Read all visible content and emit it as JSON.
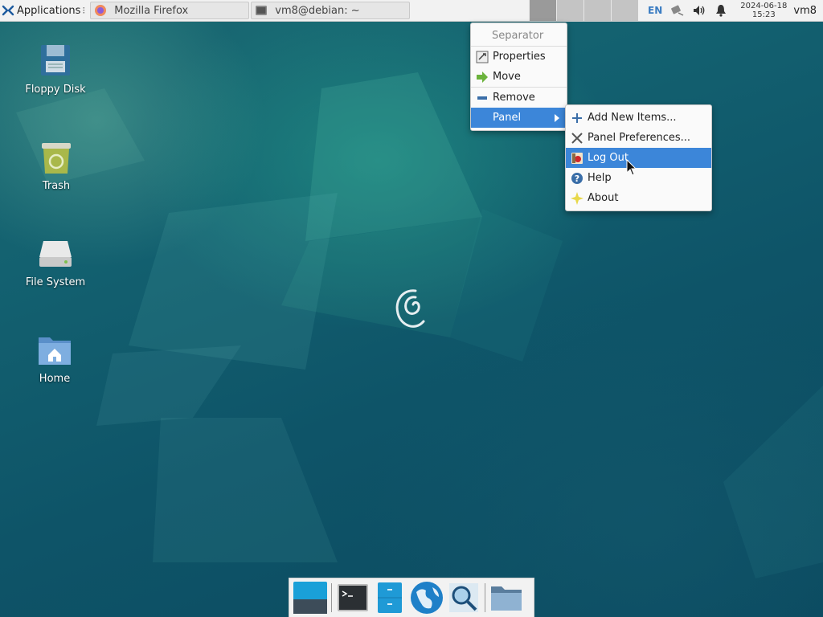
{
  "top_panel": {
    "applications_label": "Applications",
    "applications_icon": "xfce-mouse-icon",
    "tasks": [
      {
        "label": "Mozilla Firefox",
        "icon": "firefox-icon"
      },
      {
        "label": "vm8@debian: ~",
        "icon": "terminal-icon"
      }
    ],
    "workspaces": [
      {
        "index": 1,
        "active": true
      },
      {
        "index": 2,
        "active": false
      },
      {
        "index": 3,
        "active": false
      },
      {
        "index": 4,
        "active": false
      }
    ],
    "keyboard_layout": "EN",
    "clock_date": "2024-06-18",
    "clock_time": "15:23",
    "user": "vm8"
  },
  "desktop_icons": [
    {
      "label": "Floppy Disk",
      "icon": "floppy-disk-icon"
    },
    {
      "label": "Trash",
      "icon": "trash-icon"
    },
    {
      "label": "File System",
      "icon": "drive-icon"
    },
    {
      "label": "Home",
      "icon": "home-folder-icon"
    }
  ],
  "context_menu": {
    "items": [
      {
        "label": "Separator",
        "enabled": false
      },
      {
        "label": "Properties",
        "icon": "properties-icon"
      },
      {
        "label": "Move",
        "icon": "move-arrow-icon"
      },
      {
        "label": "Remove",
        "icon": "remove-icon"
      },
      {
        "label": "Panel",
        "has_submenu": true,
        "highlighted": true
      }
    ]
  },
  "panel_submenu": {
    "items": [
      {
        "label": "Add New Items...",
        "icon": "add-icon"
      },
      {
        "label": "Panel Preferences...",
        "icon": "preferences-icon"
      },
      {
        "label": "Log Out",
        "icon": "logout-icon",
        "highlighted": true
      },
      {
        "label": "Help",
        "icon": "help-icon"
      },
      {
        "label": "About",
        "icon": "about-icon"
      }
    ]
  },
  "dock": {
    "launchers": [
      "show-desktop-icon",
      "terminal-icon",
      "file-manager-icon",
      "web-browser-icon",
      "app-finder-icon",
      "folder-icon"
    ]
  },
  "colors": {
    "menu_highlight": "#3c86d9",
    "panel_bg": "#f2f2f2",
    "desktop_teal": "#136170"
  }
}
